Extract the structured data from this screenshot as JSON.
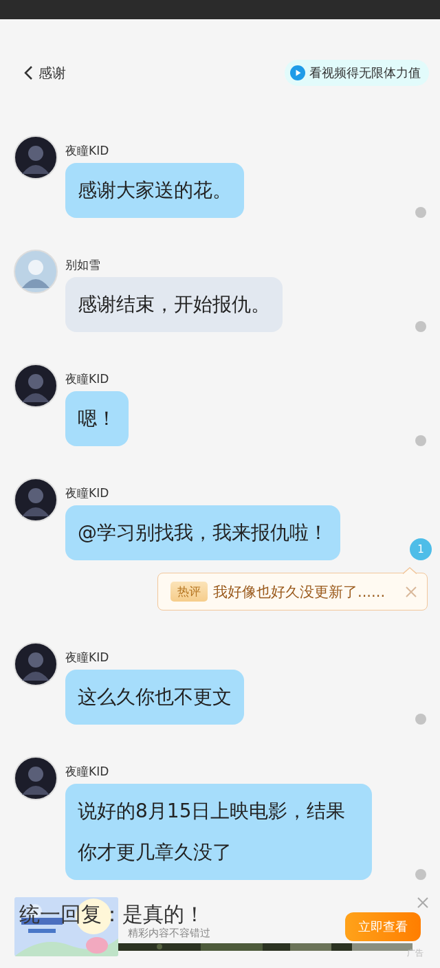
{
  "header": {
    "back_label": "感谢",
    "promo": "看视频得无限体力值"
  },
  "messages": [
    {
      "author": "夜瞳KID",
      "kind": "dark",
      "color": "#a6ddfb",
      "text": "感谢大家送的花。"
    },
    {
      "author": "别如雪",
      "kind": "light",
      "color": "#e2e8f0",
      "text": "感谢结束，开始报仇。"
    },
    {
      "author": "夜瞳KID",
      "kind": "dark",
      "color": "#a6ddfb",
      "text": "嗯！"
    },
    {
      "author": "夜瞳KID",
      "kind": "dark",
      "color": "#a6ddfb",
      "text": "@学习别找我，我来报仇啦！",
      "comment_count": "1",
      "hot_comment": {
        "tag": "热评",
        "text": "我好像也好久没更新了......"
      }
    },
    {
      "author": "夜瞳KID",
      "kind": "dark",
      "color": "#a6ddfb",
      "text": "这么久你也不更文"
    },
    {
      "author": "夜瞳KID",
      "kind": "dark",
      "color": "#a6ddfb",
      "text": "说好的8月15日上映电影，结果你才更几章久没了"
    }
  ],
  "ad": {
    "overlay_text": "统一回复：是真的！",
    "subtitle": "精彩内容不容错过",
    "button": "立即查看",
    "label": "广告"
  }
}
